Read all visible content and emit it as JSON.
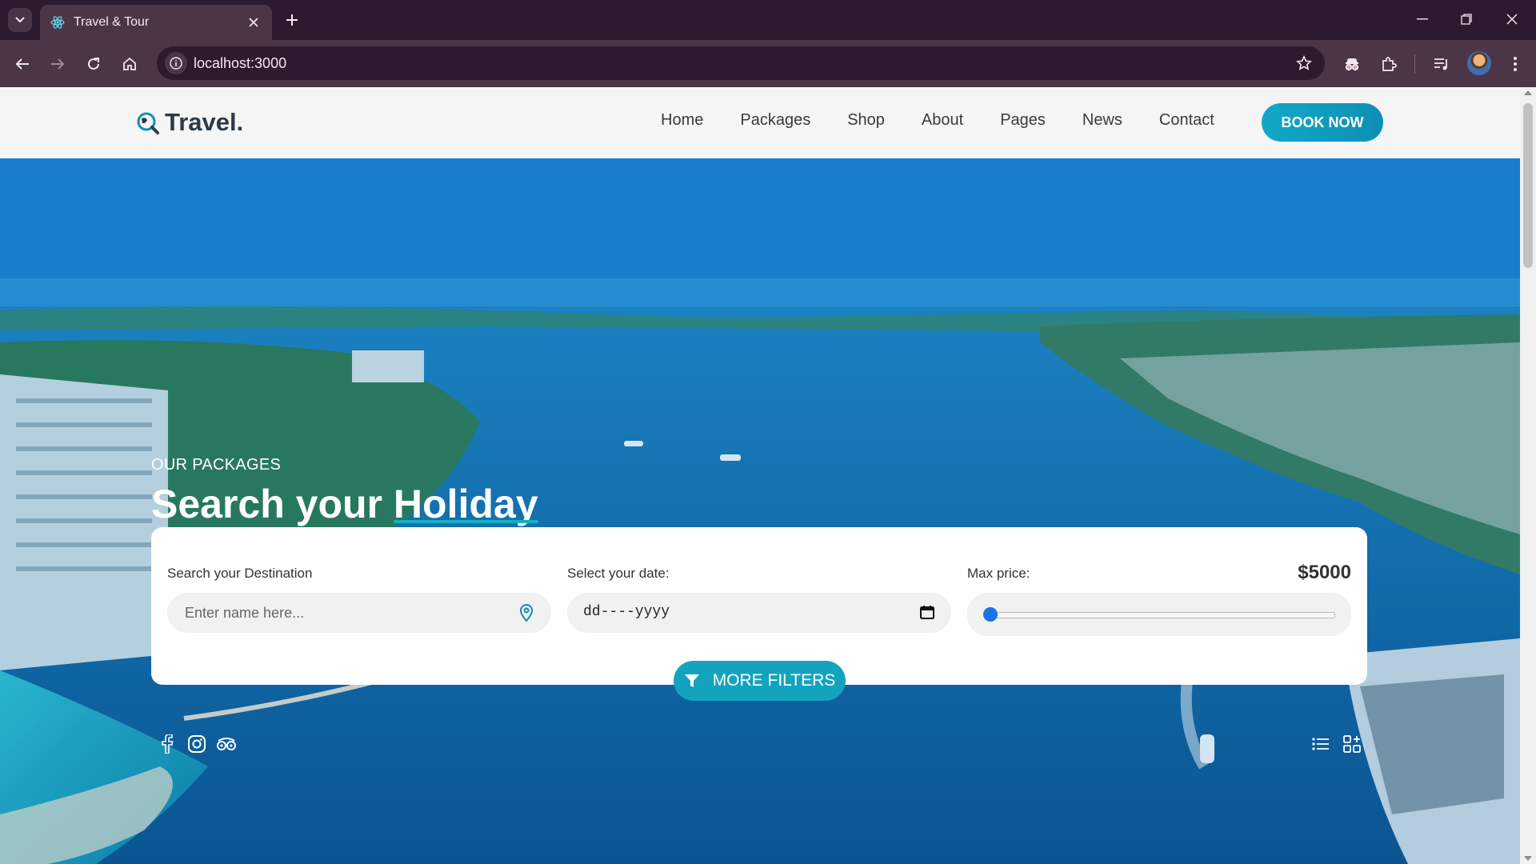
{
  "browser": {
    "tab_title": "Travel & Tour",
    "url": "localhost:3000"
  },
  "site": {
    "logo_text": "Travel.",
    "nav": [
      "Home",
      "Packages",
      "Shop",
      "About",
      "Pages",
      "News",
      "Contact"
    ],
    "cta": "BOOK NOW"
  },
  "hero": {
    "eyebrow": "OUR PACKAGES",
    "title_prefix": "Search your ",
    "title_highlight": "Holiday"
  },
  "search": {
    "destination_label": "Search your Destination",
    "destination_placeholder": "Enter name here...",
    "date_label": "Select your date:",
    "date_value": "dd----yyyy",
    "price_label": "Max price:",
    "price_value": "$5000",
    "price_slider_fraction": 0.0,
    "more_filters": "MORE FILTERS"
  },
  "icons": {
    "social": [
      "facebook-icon",
      "instagram-icon",
      "tripadvisor-icon"
    ],
    "views": [
      "list-view-icon",
      "grid-view-icon"
    ]
  },
  "colors": {
    "accent": "#14a3bf",
    "browser_frame": "#4b3547",
    "logo_text": "#2b3a4a"
  }
}
